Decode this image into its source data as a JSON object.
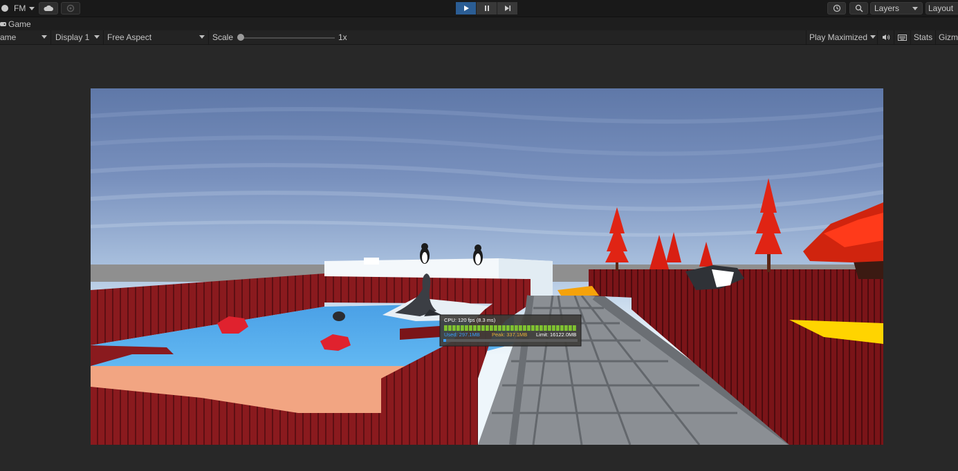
{
  "toolbar": {
    "account_label": "FM",
    "layers_label": "Layers",
    "layout_label": "Layout",
    "icons": [
      "account-icon",
      "cloud-icon",
      "collab-icon",
      "play-icon",
      "pause-icon",
      "step-icon",
      "history-icon",
      "search-icon"
    ]
  },
  "tab": {
    "title": "Game"
  },
  "game_toolbar": {
    "mode_label": "ame",
    "display_label": "Display 1",
    "aspect_label": "Free Aspect",
    "scale_label": "Scale",
    "scale_value": "1x",
    "play_mode_label": "Play Maximized",
    "stats_label": "Stats",
    "gizmos_label": "Gizm"
  },
  "perf_overlay": {
    "cpu_text": "CPU: 120 fps (8.3 ms)",
    "used_text": "Used: 297.1MB",
    "peak_text": "Peak: 337.1MB",
    "limit_text": "Limit: 16122.0MB",
    "cpu_bar_fill": 1.0,
    "memory_bar_fill": 0.02
  },
  "colors": {
    "accent_play": "#2b5d94",
    "perf_green": "#7fc230",
    "perf_used": "#3aa0ff",
    "perf_peak": "#e8b23a"
  }
}
